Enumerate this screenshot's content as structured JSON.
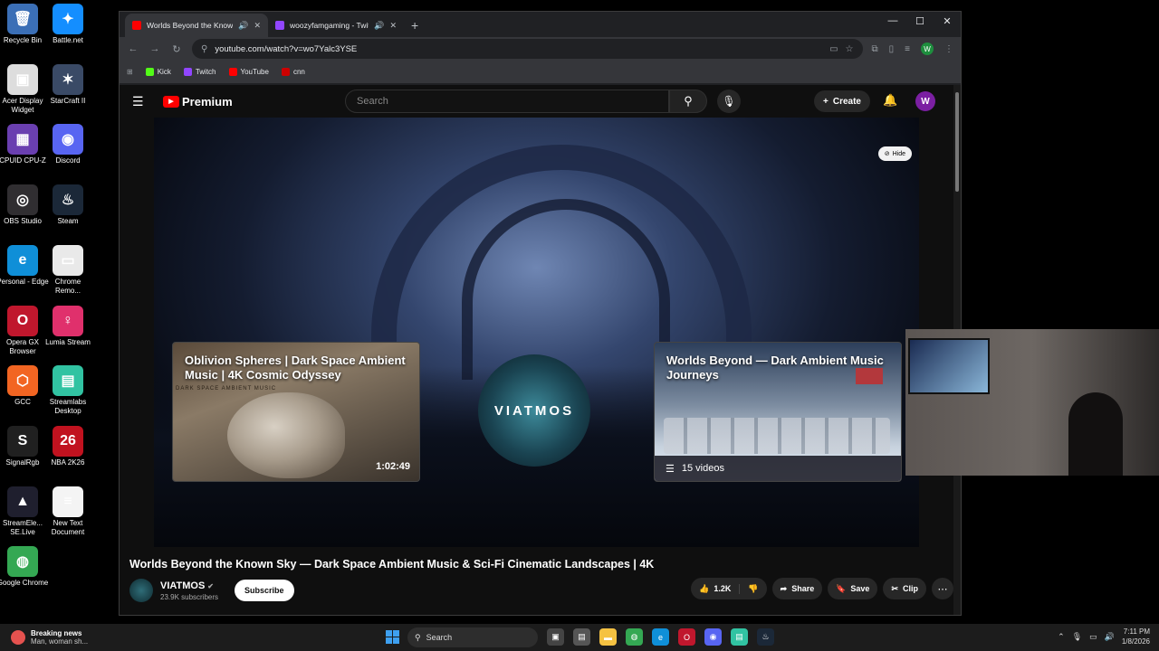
{
  "desktop": {
    "icons": [
      {
        "label": "Recycle Bin",
        "color": "#3b6fb6",
        "glyph": "🗑"
      },
      {
        "label": "Battle.net",
        "color": "#148eff",
        "glyph": "✦"
      },
      {
        "label": "Acer Display Widget",
        "color": "#dddddd",
        "glyph": "▣"
      },
      {
        "label": "StarCraft II",
        "color": "#3a4a66",
        "glyph": "✶"
      },
      {
        "label": "CPUID CPU-Z",
        "color": "#6a3fb0",
        "glyph": "▦"
      },
      {
        "label": "Discord",
        "color": "#5865f2",
        "glyph": "◉"
      },
      {
        "label": "OBS Studio",
        "color": "#302e31",
        "glyph": "◎"
      },
      {
        "label": "Steam",
        "color": "#1b2838",
        "glyph": "♨"
      },
      {
        "label": "Personal - Edge",
        "color": "#0f8fd8",
        "glyph": "e"
      },
      {
        "label": "Chrome Remo...",
        "color": "#e9e9e9",
        "glyph": "▭"
      },
      {
        "label": "Opera GX Browser",
        "color": "#c0172d",
        "glyph": "O"
      },
      {
        "label": "Lumia Stream",
        "color": "#e0306c",
        "glyph": "♀"
      },
      {
        "label": "GCC",
        "color": "#f26522",
        "glyph": "⬡"
      },
      {
        "label": "Streamlabs Desktop",
        "color": "#31c3a2",
        "glyph": "▤"
      },
      {
        "label": "SignalRgb",
        "color": "#202020",
        "glyph": "S"
      },
      {
        "label": "NBA 2K26",
        "color": "#c1121f",
        "glyph": "26"
      },
      {
        "label": "StreamEle... SE.Live",
        "color": "#1f1f2e",
        "glyph": "▲"
      },
      {
        "label": "New Text Document",
        "color": "#f4f4f4",
        "glyph": "≡"
      },
      {
        "label": "Google Chrome",
        "color": "#34a853",
        "glyph": "◍"
      }
    ]
  },
  "browser": {
    "tabs": [
      {
        "title": "Worlds Beyond the Known",
        "favicon_color": "#ff0000"
      },
      {
        "title": "woozyfamgaming - Twitch",
        "favicon_color": "#9146ff"
      }
    ],
    "new_tab": "+",
    "url": "youtube.com/watch?v=wo7Yalc3YSE",
    "bookmarks": [
      {
        "label": "Kick",
        "color": "#53fc18"
      },
      {
        "label": "Twitch",
        "color": "#9146ff"
      },
      {
        "label": "YouTube",
        "color": "#ff0000"
      },
      {
        "label": "cnn",
        "color": "#cc0000"
      }
    ],
    "profile_initial": "W"
  },
  "youtube": {
    "logo_text": "Premium",
    "search_placeholder": "Search",
    "create_label": "Create",
    "avatar_initial": "W",
    "hide_label": "Hide",
    "card1": {
      "title": "Oblivion Spheres | Dark Space Ambient Music | 4K Cosmic Odyssey",
      "duration": "1:02:49",
      "inner_text": "DARK SPACE AMBIENT MUSIC"
    },
    "card2": {
      "title": "Worlds Beyond — Dark Ambient Music Journeys",
      "count": "15 videos"
    },
    "channel_logo": "VIATMOS",
    "video_title": "Worlds Beyond the Known Sky — Dark Space Ambient Music & Sci-Fi Cinematic Landscapes | 4K",
    "channel_name": "VIATMOS",
    "subscribers": "23.9K subscribers",
    "subscribe_label": "Subscribe",
    "likes": "1.2K",
    "share_label": "Share",
    "save_label": "Save",
    "clip_label": "Clip"
  },
  "taskbar": {
    "news_title": "Breaking news",
    "news_sub": "Man, woman sh...",
    "search_label": "Search",
    "time": "7:11 PM",
    "date": "1/8/2026"
  }
}
